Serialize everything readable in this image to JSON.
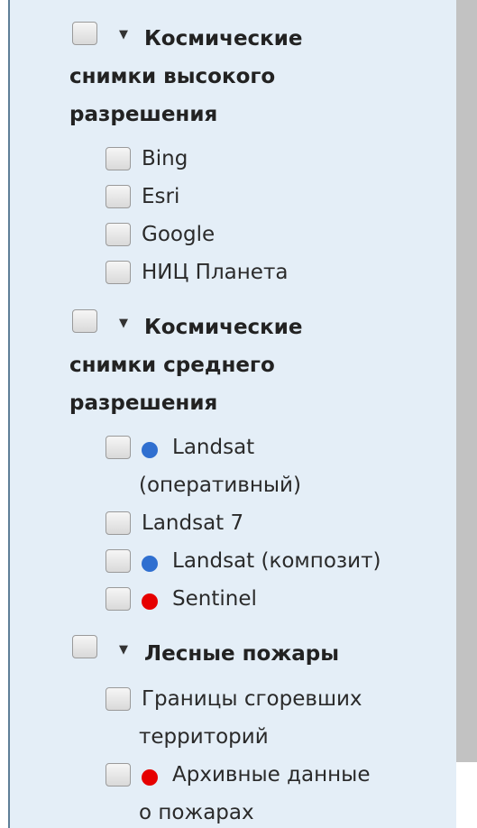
{
  "colors": {
    "panel_bg": "#e4eef7",
    "border": "#5f7f97",
    "scroll_thumb": "#c2c2c2",
    "blue_dot": "#2f6fd0",
    "red_dot": "#e60000"
  },
  "groups": [
    {
      "title_line1": "Космические",
      "title_line2": "снимки высокого",
      "title_line3": "разрешения",
      "items": [
        {
          "label": "Bing"
        },
        {
          "label": "Esri"
        },
        {
          "label": "Google"
        },
        {
          "label": "НИЦ Планета"
        }
      ]
    },
    {
      "title_line1": "Космические",
      "title_line2": "снимки среднего",
      "title_line3": "разрешения",
      "items": [
        {
          "label_line1": "Landsat",
          "label_line2": "(оперативный)",
          "dot": "blue"
        },
        {
          "label": "Landsat 7"
        },
        {
          "label": "Landsat (композит)",
          "dot": "blue"
        },
        {
          "label": "Sentinel",
          "dot": "red"
        }
      ]
    },
    {
      "title_line1": "Лесные пожары",
      "items": [
        {
          "label_line1": "Границы сгоревших",
          "label_line2": "территорий"
        },
        {
          "label_line1": "Архивные данные",
          "label_line2": "о пожарах",
          "dot": "red"
        }
      ]
    }
  ],
  "icons": {
    "checkbox": "checkbox-icon",
    "expand_arrow": "triangle-down-icon",
    "status_dot": "circle-icon"
  }
}
